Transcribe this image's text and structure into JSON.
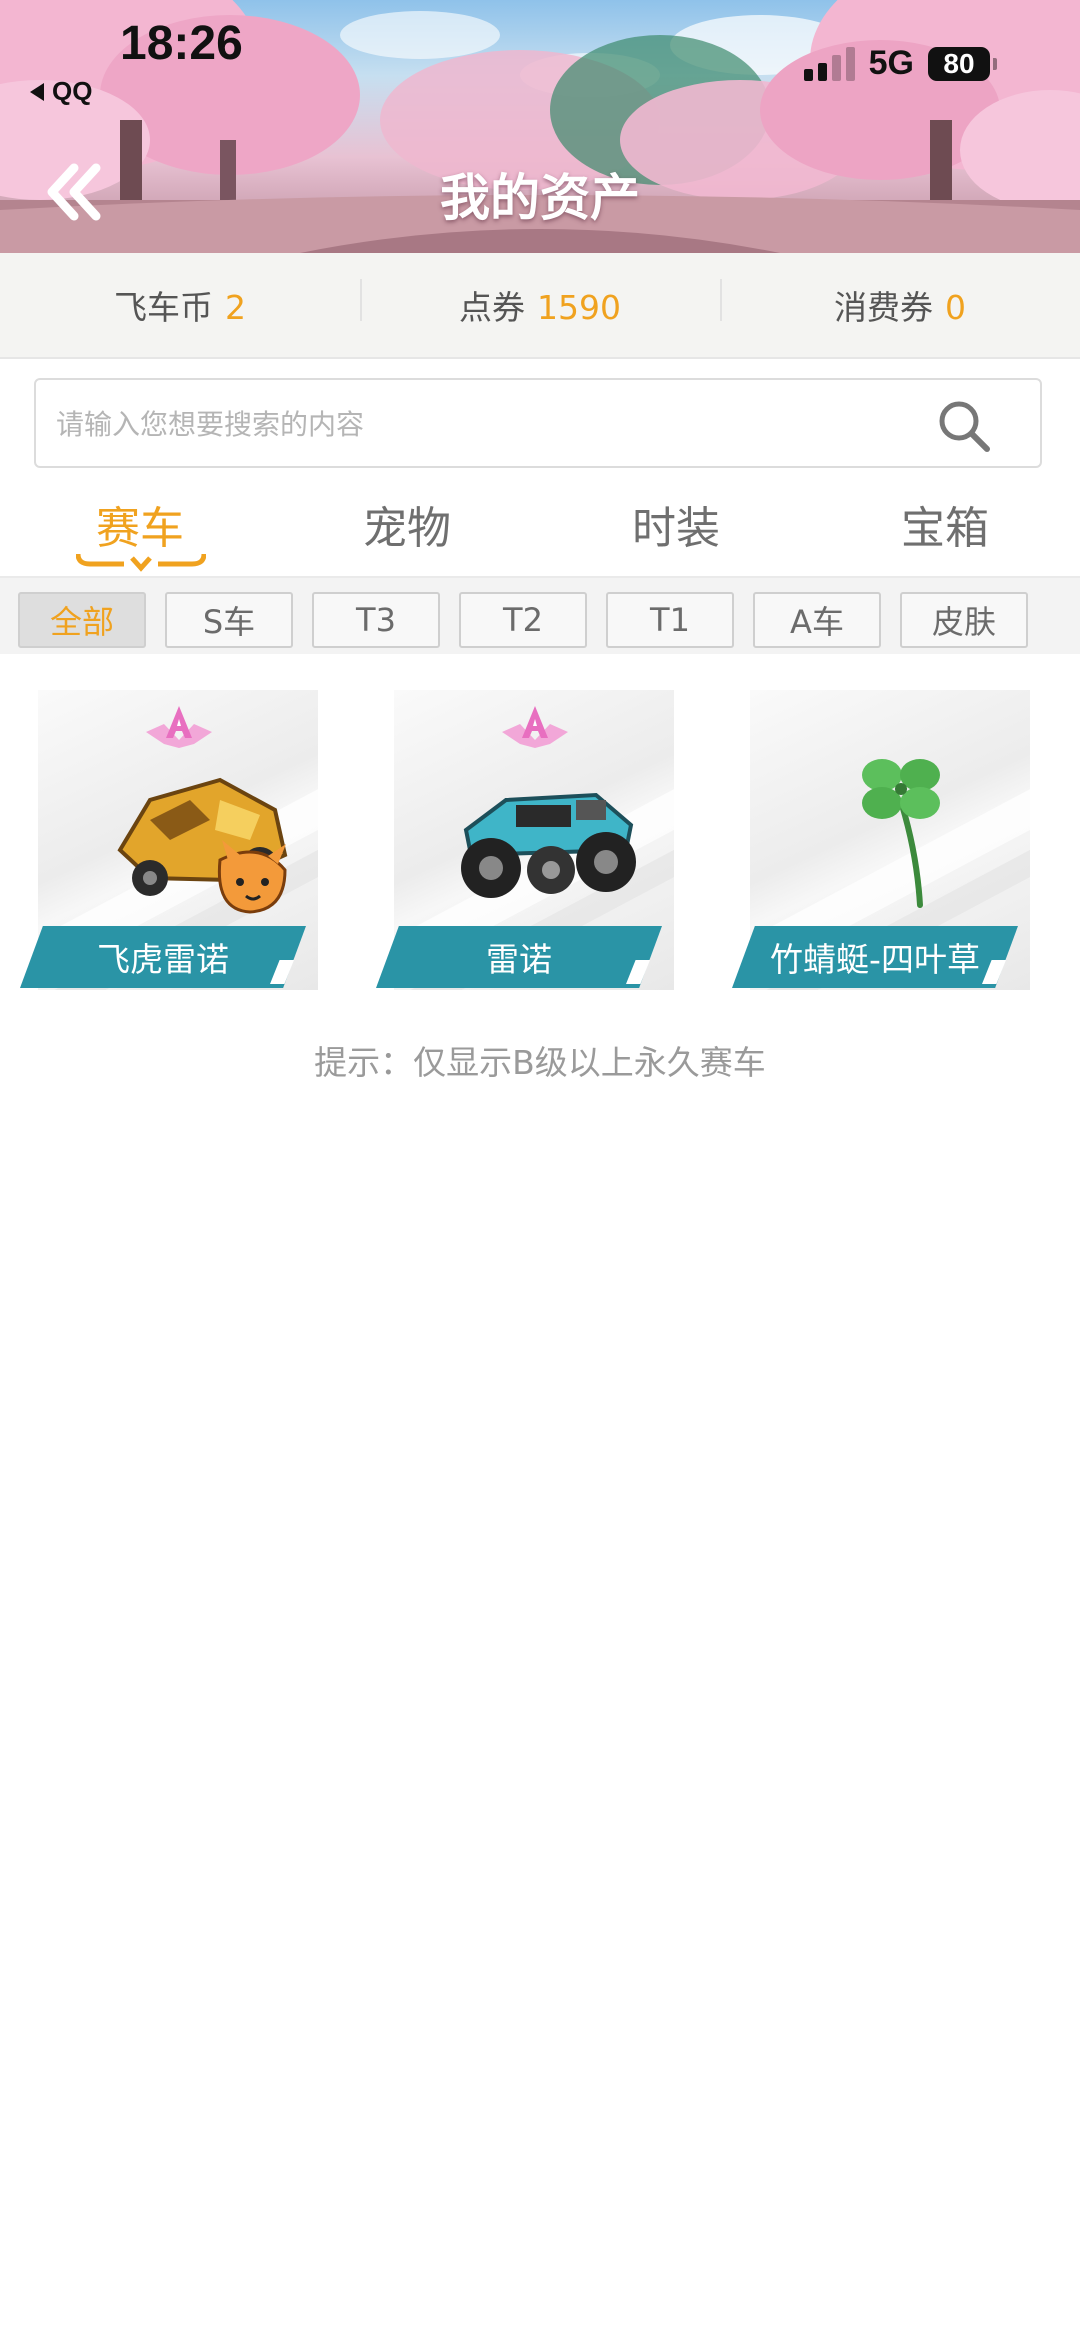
{
  "status_bar": {
    "time": "18:26",
    "back_app": "QQ",
    "network": "5G",
    "battery": "80"
  },
  "header": {
    "title": "我的资产"
  },
  "currencies": [
    {
      "label": "飞车币",
      "value": "2"
    },
    {
      "label": "点券",
      "value": "1590"
    },
    {
      "label": "消费券",
      "value": "0"
    }
  ],
  "search": {
    "placeholder": "请输入您想要搜索的内容",
    "value": ""
  },
  "tabs": [
    {
      "label": "赛车",
      "active": true
    },
    {
      "label": "宠物",
      "active": false
    },
    {
      "label": "时装",
      "active": false
    },
    {
      "label": "宝箱",
      "active": false
    }
  ],
  "filters": [
    {
      "label": "全部",
      "active": true
    },
    {
      "label": "S车",
      "active": false
    },
    {
      "label": "T3",
      "active": false
    },
    {
      "label": "T2",
      "active": false
    },
    {
      "label": "T1",
      "active": false
    },
    {
      "label": "A车",
      "active": false
    },
    {
      "label": "皮肤",
      "active": false
    }
  ],
  "items": [
    {
      "name": "飞虎雷诺",
      "grade": "A"
    },
    {
      "name": "雷诺",
      "grade": "A"
    },
    {
      "name": "竹蜻蜓-四叶草"
    }
  ],
  "hint": "提示：仅显示B级以上永久赛车",
  "colors": {
    "accent": "#f0a21f",
    "label_bg": "#2a94a6",
    "grade_pink": "#e86fc0"
  }
}
